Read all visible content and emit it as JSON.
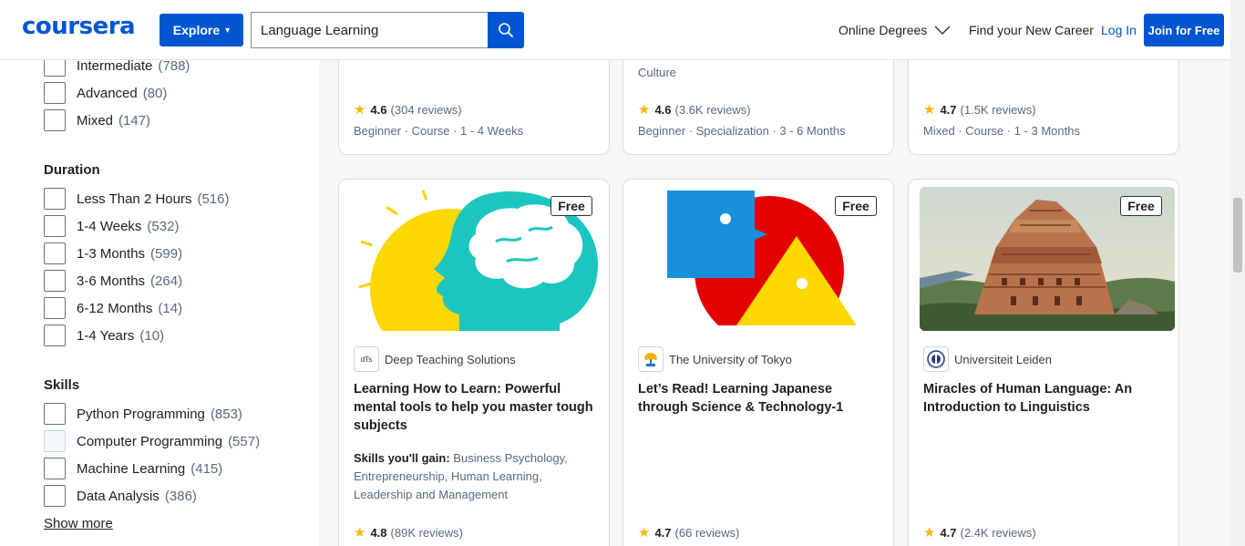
{
  "header": {
    "logo": "coursera",
    "explore": "Explore",
    "search_value": "Language Learning",
    "online_degrees": "Online Degrees",
    "find_career": "Find your New Career",
    "login": "Log In",
    "join": "Join for Free"
  },
  "sidebar": {
    "level_items": [
      {
        "label": "Intermediate",
        "count": "(788)"
      },
      {
        "label": "Advanced",
        "count": "(80)"
      },
      {
        "label": "Mixed",
        "count": "(147)"
      }
    ],
    "duration_title": "Duration",
    "duration_items": [
      {
        "label": "Less Than 2 Hours",
        "count": "(516)"
      },
      {
        "label": "1-4 Weeks",
        "count": "(532)"
      },
      {
        "label": "1-3 Months",
        "count": "(599)"
      },
      {
        "label": "3-6 Months",
        "count": "(264)"
      },
      {
        "label": "6-12 Months",
        "count": "(14)"
      },
      {
        "label": "1-4 Years",
        "count": "(10)"
      }
    ],
    "skills_title": "Skills",
    "skills_items": [
      {
        "label": "Python Programming",
        "count": "(853)"
      },
      {
        "label": "Computer Programming",
        "count": "(557)"
      },
      {
        "label": "Machine Learning",
        "count": "(415)"
      },
      {
        "label": "Data Analysis",
        "count": "(386)"
      }
    ],
    "show_more": "Show more"
  },
  "top_cards": [
    {
      "cut_text": "",
      "rating": "4.6",
      "reviews": "(304 reviews)",
      "meta": "Beginner · Course · 1 - 4 Weeks"
    },
    {
      "cut_text": "Culture",
      "rating": "4.6",
      "reviews": "(3.6K reviews)",
      "meta": "Beginner · Specialization · 3 - 6 Months"
    },
    {
      "cut_text": "",
      "rating": "4.7",
      "reviews": "(1.5K reviews)",
      "meta": "Mixed · Course · 1 - 3 Months"
    }
  ],
  "cards": [
    {
      "badge": "Free",
      "partner": "Deep Teaching Solutions",
      "partner_logo_text": "dTs",
      "title": "Learning How to Learn: Powerful mental tools to help you master tough subjects",
      "skills_label": "Skills you'll gain:",
      "skills": "Business Psychology, Entrepreneurship, Human Learning, Leadership and Management",
      "rating": "4.8",
      "reviews": "(89K reviews)"
    },
    {
      "badge": "Free",
      "partner": "The University of Tokyo",
      "title": "Let’s Read! Learning Japanese through Science & Technology-1",
      "rating": "4.7",
      "reviews": "(66 reviews)"
    },
    {
      "badge": "Free",
      "partner": "Universiteit Leiden",
      "title": "Miracles of Human Language: An Introduction to Linguistics",
      "rating": "4.7",
      "reviews": "(2.4K reviews)"
    }
  ],
  "colors": {
    "brand": "#0056d2",
    "star": "#f5b70a"
  }
}
